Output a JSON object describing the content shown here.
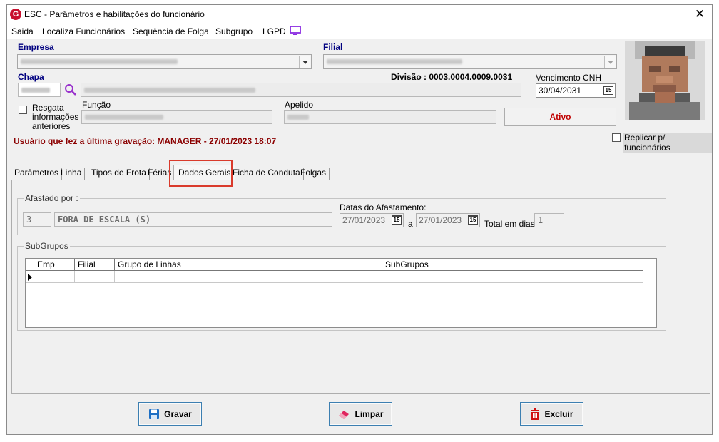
{
  "window": {
    "title": "ESC - Parâmetros e habilitações do funcionário",
    "logo_letter": "G"
  },
  "menu": {
    "items": [
      "Saida",
      "Localiza Funcionários",
      "Sequência de Folga",
      "Subgrupo",
      "LGPD"
    ]
  },
  "form": {
    "empresa_label": "Empresa",
    "filial_label": "Filial",
    "chapa_label": "Chapa",
    "divisao_text": "Divisão : 0003.0004.0009.0031",
    "vencimento_label": "Vencimento  CNH",
    "vencimento_value": "30/04/2031",
    "resgata_label_1": "Resgata",
    "resgata_label_2": "informações",
    "resgata_label_3": "anteriores",
    "funcao_label": "Função",
    "apelido_label": "Apelido",
    "status_button": "Ativo",
    "replicar_label": "Replicar p/ funcionários",
    "last_save_text": "Usuário que fez a última gravação: MANAGER - 27/01/2023 18:07"
  },
  "tabs": [
    "Parâmetros",
    "Linha",
    "Tipos de Frota",
    "Férias",
    "Dados Gerais",
    "Ficha de Conduta",
    "Folgas"
  ],
  "active_tab": "Dados Gerais",
  "dados_gerais": {
    "afastado_legend": "Afastado por :",
    "afastado_code": "3",
    "afastado_desc": "FORA DE ESCALA (S)",
    "datas_label": "Datas do Afastamento:",
    "data_inicio": "27/01/2023",
    "a_label": "a",
    "data_fim": "27/01/2023",
    "total_label": "Total em dias:",
    "total_value": "1",
    "subgrupos_legend": "SubGrupos",
    "grid_columns": [
      "Emp",
      "Filial",
      "Grupo de Linhas",
      "SubGrupos"
    ]
  },
  "buttons": {
    "gravar": "Gravar",
    "limpar": "Limpar",
    "excluir": "Excluir"
  },
  "calendar_icon_text": "15",
  "colors": {
    "accent_red": "#c8102e",
    "label_blue": "#000080",
    "status_red": "#c00000",
    "highlight_red": "#d93a2b",
    "lgpd_purple": "#8a2be2"
  }
}
